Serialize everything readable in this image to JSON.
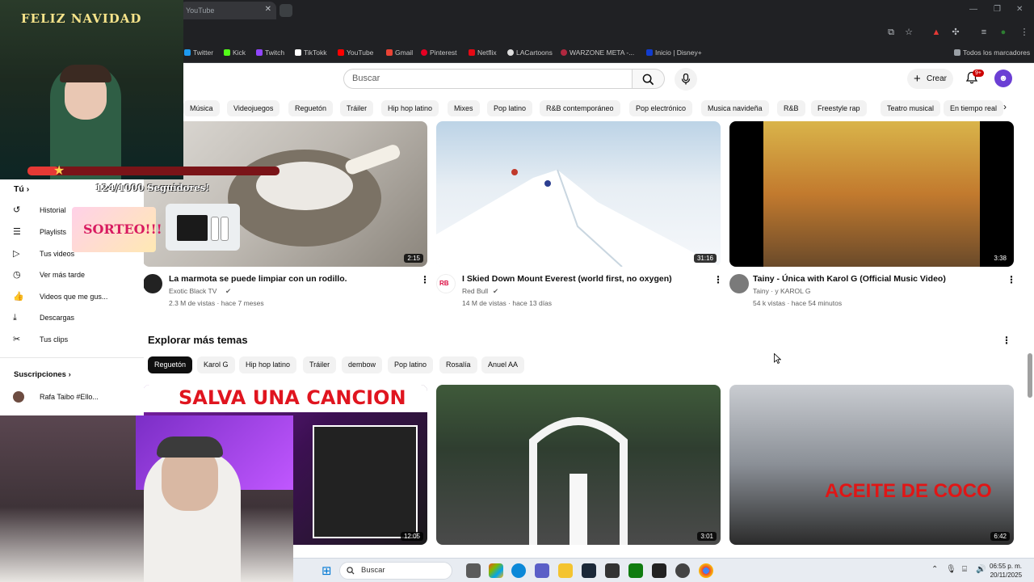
{
  "browser": {
    "tab_title": "YouTube",
    "bookmarks": [
      {
        "label": "Twitter",
        "color": "#1d9bf0"
      },
      {
        "label": "Kick",
        "color": "#53fc18"
      },
      {
        "label": "Twitch",
        "color": "#9146ff"
      },
      {
        "label": "TikTokk",
        "color": "#ffffff"
      },
      {
        "label": "YouTube",
        "color": "#ff0000"
      },
      {
        "label": "Gmail",
        "color": "#ea4335"
      },
      {
        "label": "Pinterest",
        "color": "#e60023"
      },
      {
        "label": "Netflix",
        "color": "#e50914"
      },
      {
        "label": "LACartoons",
        "color": "#dddddd"
      },
      {
        "label": "WARZONE META -...",
        "color": "#b0283f"
      },
      {
        "label": "Inicio | Disney+",
        "color": "#113ccf"
      }
    ],
    "all_bookmarks_label": "Todos los marcadores"
  },
  "header": {
    "search_placeholder": "Buscar",
    "create_label": "Crear",
    "notifications_badge": "9+",
    "avatar_letter": "☻"
  },
  "chips": [
    "Música",
    "Videojuegos",
    "Reguetón",
    "Tráiler",
    "Hip hop latino",
    "Mixes",
    "Pop latino",
    "R&B contemporáneo",
    "Pop electrónico",
    "Musica navideña",
    "R&B",
    "Freestyle rap",
    "Teatro musical",
    "En tiempo real"
  ],
  "videos_row1": [
    {
      "title": "La marmota se puede limpiar con un rodillo.",
      "channel": "Exotic Black TV",
      "meta": "2.3 M de vistas · hace 7 meses",
      "duration": "2:15",
      "verified": true
    },
    {
      "title": "I Skied Down Mount Everest (world first, no oxygen)",
      "channel": "Red Bull",
      "meta": "14 M de vistas · hace 13 días",
      "duration": "31:16",
      "verified": true
    },
    {
      "title": "Tainy - Única with Karol G (Official Music Video)",
      "channel": "Tainy · y KAROL G",
      "meta": "54 k vistas · hace 54 minutos",
      "duration": "3:38",
      "verified": true
    }
  ],
  "explore": {
    "title": "Explorar más temas",
    "chips": [
      "Reguetón",
      "Karol G",
      "Hip hop latino",
      "Tráiler",
      "dembow",
      "Pop latino",
      "Rosalía",
      "Anuel AA"
    ]
  },
  "videos_row2": [
    {
      "thumb_text": "SALVA UNA CANCION",
      "duration": "12:05"
    },
    {
      "thumb_text": "",
      "duration": "3:01"
    },
    {
      "thumb_text": "ACEITE DE COCO",
      "duration": "6:42"
    }
  ],
  "sidebar": {
    "you_label": "Tú",
    "items": [
      {
        "icon": "history-icon",
        "label": "Historial"
      },
      {
        "icon": "playlist-icon",
        "label": "Playlists"
      },
      {
        "icon": "your-videos-icon",
        "label": "Tus videos"
      },
      {
        "icon": "watch-later-icon",
        "label": "Ver más tarde"
      },
      {
        "icon": "liked-icon",
        "label": "Videos que me gus..."
      },
      {
        "icon": "download-icon",
        "label": "Descargas"
      },
      {
        "icon": "clips-icon",
        "label": "Tus clips"
      }
    ],
    "subscriptions_label": "Suscripciones",
    "subscriptions": [
      {
        "label": "Rafa Taibo #Ello..."
      }
    ]
  },
  "stream_overlay": {
    "christmas_text": "FELIZ NAVIDAD",
    "followers_text": "124/1000 Seguidores!",
    "giveaway_text": "SORTEO!!!"
  },
  "taskbar": {
    "search_label": "Buscar",
    "time": "06:55 p. m.",
    "date": "20/11/2025"
  }
}
